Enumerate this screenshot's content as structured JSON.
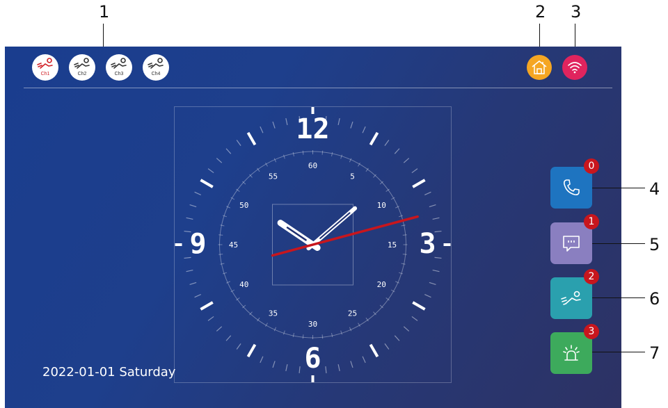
{
  "callouts": {
    "c1": "1",
    "c2": "2",
    "c3": "3",
    "c4": "4",
    "c5": "5",
    "c6": "6",
    "c7": "7"
  },
  "channels": [
    {
      "label": "Ch1",
      "icon": "motion-icon",
      "active": true
    },
    {
      "label": "Ch2",
      "icon": "motion-icon",
      "active": false
    },
    {
      "label": "Ch3",
      "icon": "motion-icon",
      "active": false
    },
    {
      "label": "Ch4",
      "icon": "motion-icon",
      "active": false
    }
  ],
  "status": {
    "home_icon": "home-icon",
    "wifi_icon": "wifi-icon",
    "home_color": "#f5a623",
    "wifi_color": "#e0245e"
  },
  "date_text": "2022-01-01  Saturday",
  "clock": {
    "hour_labels": [
      "12",
      "3",
      "6",
      "9"
    ],
    "minute_labels": [
      "60",
      "5",
      "10",
      "15",
      "20",
      "25",
      "30",
      "35",
      "40",
      "45",
      "50",
      "55"
    ],
    "time": {
      "hour": 10,
      "minute": 8,
      "second": 12.5
    }
  },
  "side_buttons": [
    {
      "name": "call-log",
      "icon": "phone-icon",
      "badge": "0",
      "color": "#1e74c0"
    },
    {
      "name": "messages",
      "icon": "message-icon",
      "badge": "1",
      "color": "#8a7fc0"
    },
    {
      "name": "motion-events",
      "icon": "motion-icon",
      "badge": "2",
      "color": "#2aa0ae"
    },
    {
      "name": "alarm",
      "icon": "alarm-icon",
      "badge": "3",
      "color": "#3daa5c"
    }
  ]
}
